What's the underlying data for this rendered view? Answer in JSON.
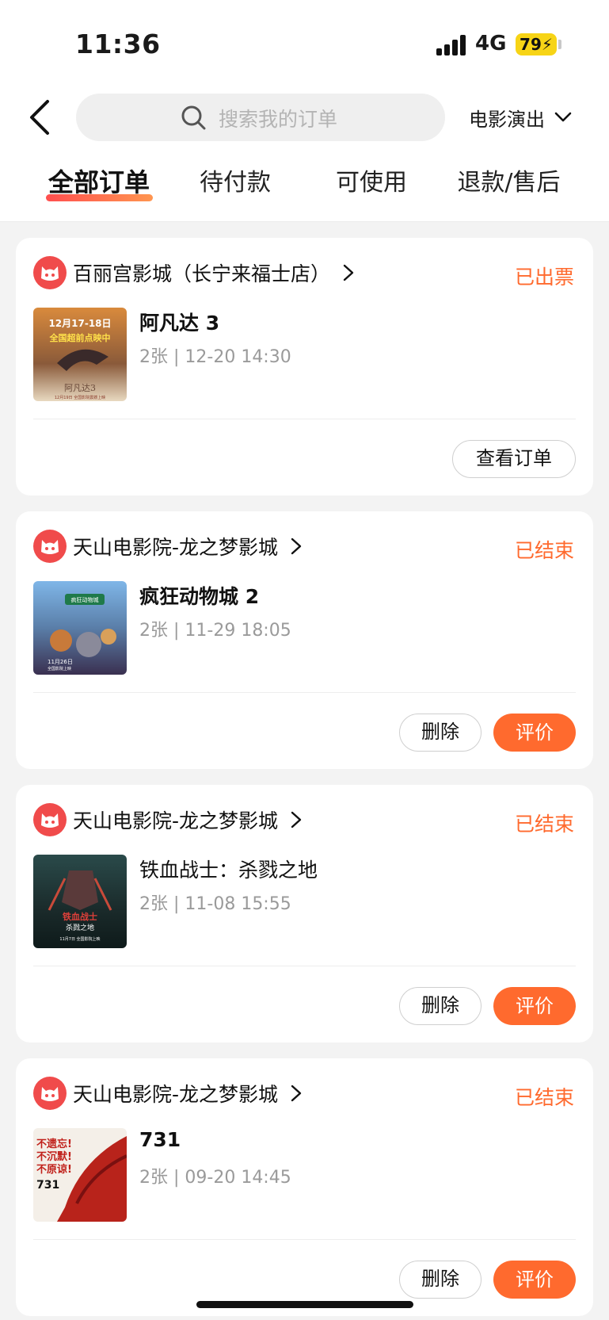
{
  "status_bar": {
    "time": "11:36",
    "network": "4G",
    "battery": "79"
  },
  "search": {
    "placeholder": "搜索我的订单"
  },
  "category_filter": "电影演出",
  "tabs": [
    {
      "label": "全部订单",
      "active": true
    },
    {
      "label": "待付款",
      "active": false
    },
    {
      "label": "可使用",
      "active": false
    },
    {
      "label": "退款/售后",
      "active": false
    }
  ],
  "colors": {
    "accent": "#ff6a2e",
    "page_bg": "#f3f3f3",
    "battery": "#f7d416"
  },
  "orders": [
    {
      "cinema": "百丽宫影城（长宁来福士店）",
      "status": "已出票",
      "movie": "阿凡达 3",
      "meta": "2张 | 12-20 14:30",
      "actions": [
        "查看订单"
      ],
      "poster_text": [
        "12月17-18日",
        "全国超前点映中",
        "阿凡达3",
        "12月19日 全国影院震撼上映"
      ]
    },
    {
      "cinema": "天山电影院-龙之梦影城",
      "status": "已结束",
      "movie": "疯狂动物城 2",
      "meta": "2张 | 11-29 18:05",
      "actions": [
        "删除",
        "评价"
      ],
      "poster_text": [
        "疯狂动物城",
        "11月26日",
        "全国影院上映"
      ]
    },
    {
      "cinema": "天山电影院-龙之梦影城",
      "status": "已结束",
      "movie": "铁血战士：杀戮之地",
      "meta": "2张 | 11-08 15:55",
      "actions": [
        "删除",
        "评价"
      ],
      "poster_text": [
        "铁血战士",
        "杀戮之地",
        "11月7日 全国影院上映"
      ]
    },
    {
      "cinema": "天山电影院-龙之梦影城",
      "status": "已结束",
      "movie": "731",
      "meta": "2张 | 09-20 14:45",
      "actions": [
        "删除",
        "评价"
      ],
      "poster_text": [
        "不遗忘!",
        "不沉默!",
        "不原谅!",
        "731"
      ]
    }
  ],
  "icons": {
    "back": "chevron-left-icon",
    "search": "search-icon",
    "dropdown": "chevron-down-icon",
    "cinema": "maoyan-cat-icon",
    "cinema_link": "chevron-right-icon"
  }
}
